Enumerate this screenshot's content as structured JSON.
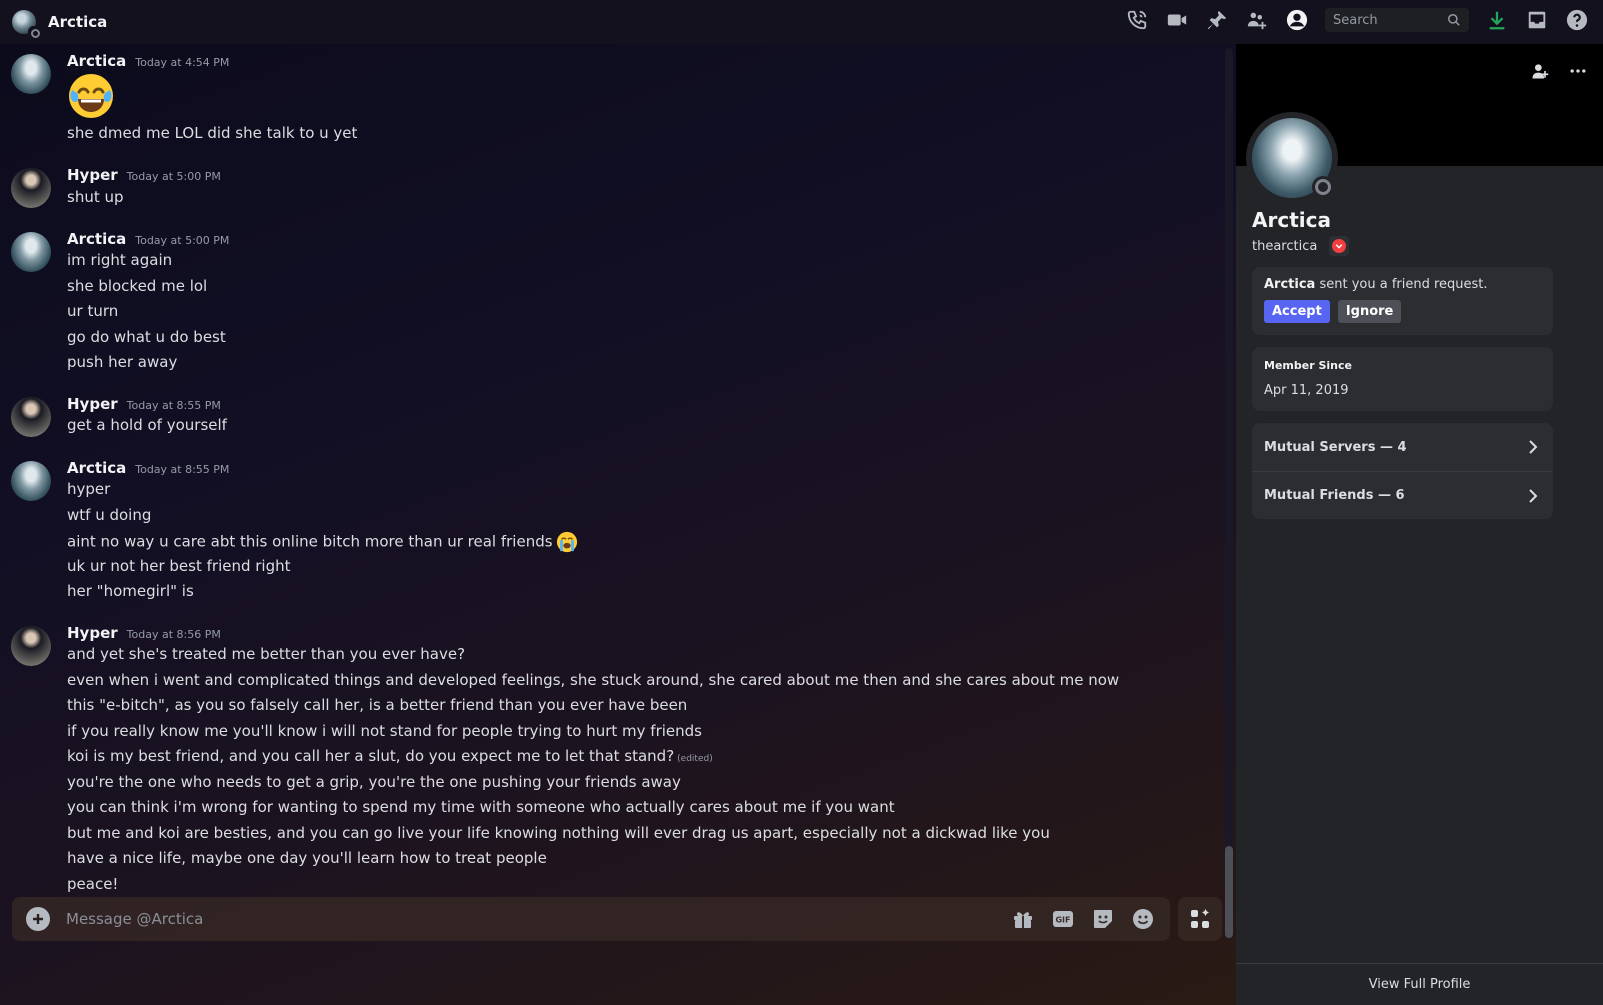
{
  "header": {
    "title": "Arctica",
    "search_placeholder": "Search",
    "icons": [
      "phone-icon",
      "video-icon",
      "pin-icon",
      "add-friends-icon",
      "profile-toggle-icon",
      "search-icon",
      "download-icon",
      "inbox-icon",
      "help-icon"
    ]
  },
  "messages": [
    {
      "author": "Arctica",
      "timestamp": "Today at 4:54 PM",
      "big_emoji": "joy-emoji",
      "lines": [
        "she dmed me LOL did she talk to u yet"
      ]
    },
    {
      "author": "Hyper",
      "timestamp": "Today at 5:00 PM",
      "lines": [
        "shut up"
      ]
    },
    {
      "author": "Arctica",
      "timestamp": "Today at 5:00 PM",
      "lines": [
        "im right again",
        "she blocked me lol",
        "ur turn",
        "go do what u do best",
        "push her away"
      ]
    },
    {
      "author": "Hyper",
      "timestamp": "Today at 8:55 PM",
      "lines": [
        "get a hold of yourself"
      ]
    },
    {
      "author": "Arctica",
      "timestamp": "Today at 8:55 PM",
      "lines": [
        "hyper",
        "wtf u doing",
        "aint no way u care abt this online bitch more than ur real friends",
        "uk ur not her best friend right",
        "her \"homegirl\" is"
      ]
    },
    {
      "author": "Hyper",
      "timestamp": "Today at 8:56 PM",
      "lines": [
        "and yet she's treated me better than you ever have?",
        "even when i went and complicated things and developed feelings, she stuck around, she cared about me then and she cares about me now",
        "this \"e-bitch\", as you so falsely call her, is a better friend than you ever have been",
        "if you really know me you'll know i will not stand for people trying to hurt my friends",
        "koi is my best friend, and you call her a slut, do you expect me to let that stand?",
        "you're the one who needs to get a grip, you're the one pushing your friends away",
        "you can think i'm wrong for wanting to spend my time with someone who actually cares about me if you want",
        "but me and koi are besties, and you can go live your life knowing nothing will ever drag us apart, especially not a dickwad like you",
        "have a nice life, maybe one day you'll learn how to treat people",
        "peace!"
      ],
      "edited_label": "(edited)"
    }
  ],
  "composer": {
    "placeholder": "Message @Arctica",
    "icons": [
      "gift-icon",
      "gif-icon",
      "sticker-icon",
      "emoji-icon"
    ],
    "gif_label": "GIF"
  },
  "profile": {
    "display_name": "Arctica",
    "username": "thearctica",
    "friend_request": {
      "name": "Arctica",
      "text": " sent you a friend request.",
      "accept_label": "Accept",
      "ignore_label": "Ignore"
    },
    "member_since_label": "Member Since",
    "member_since_value": "Apr 11, 2019",
    "mutual_servers": "Mutual Servers — 4",
    "mutual_friends": "Mutual Friends — 6",
    "view_full_profile": "View Full Profile"
  },
  "colors": {
    "accent": "#5865f2",
    "download": "#23a55a",
    "badge": "#f23f42"
  }
}
